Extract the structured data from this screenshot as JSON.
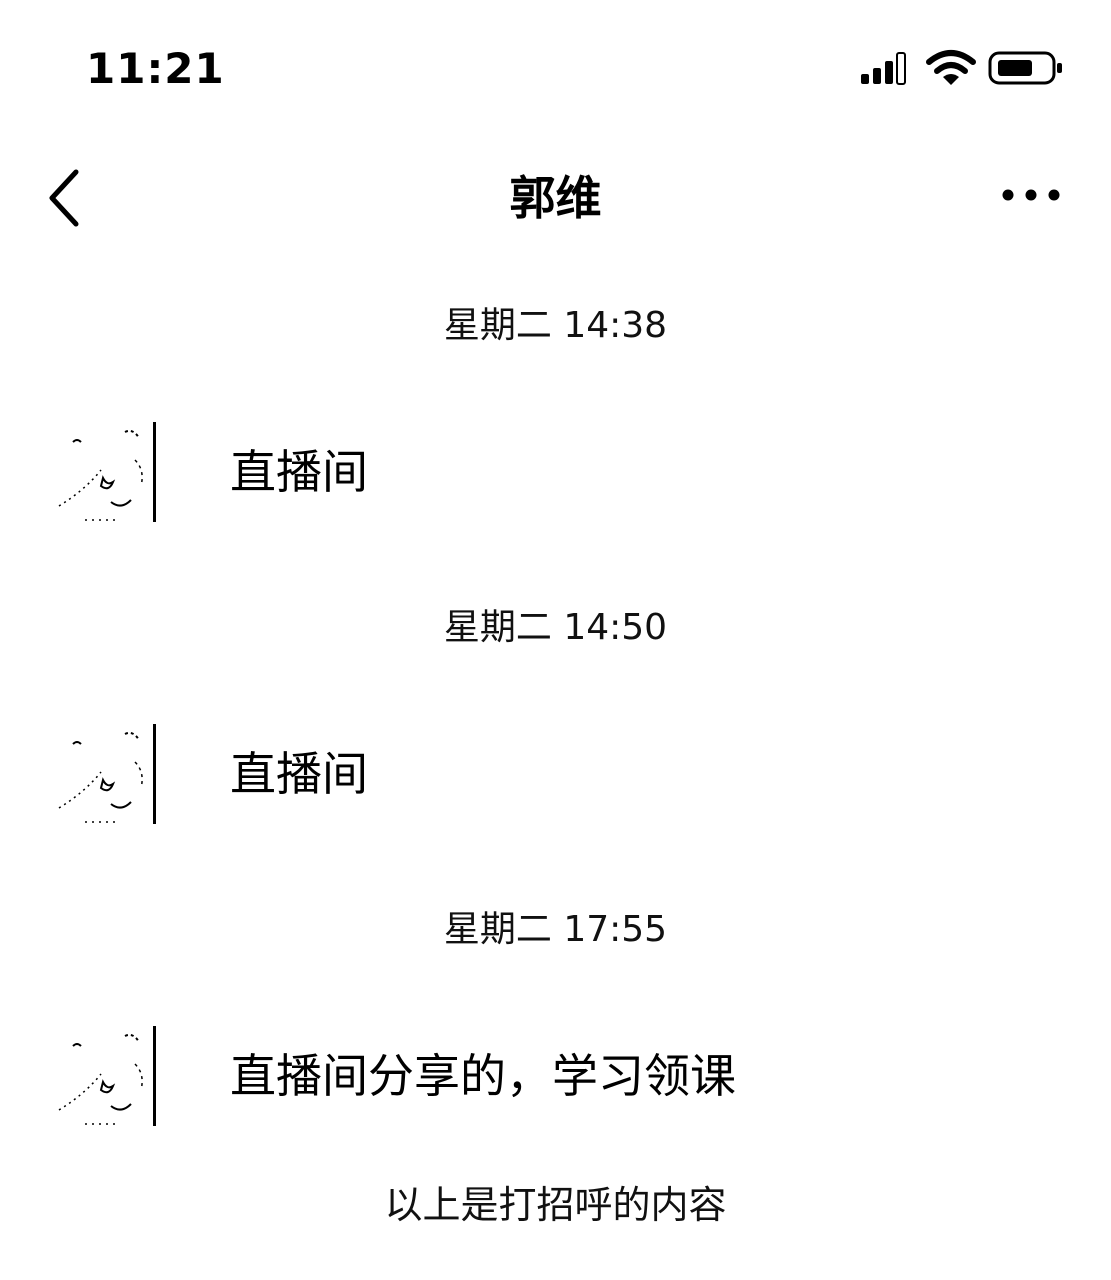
{
  "status_bar": {
    "time": "11:21",
    "icons": [
      "signal-icon",
      "wifi-icon",
      "battery-icon"
    ]
  },
  "nav": {
    "title": "郭维",
    "back_icon": "chevron-left-icon",
    "more_icon": "more-icon"
  },
  "messages": [
    {
      "timestamp": "星期二 14:38",
      "text": "直播间"
    },
    {
      "timestamp": "星期二 14:50",
      "text": "直播间"
    },
    {
      "timestamp": "星期二 17:55",
      "text": "直播间分享的，学习领课"
    }
  ],
  "footer": {
    "note": "以上是打招呼的内容"
  }
}
